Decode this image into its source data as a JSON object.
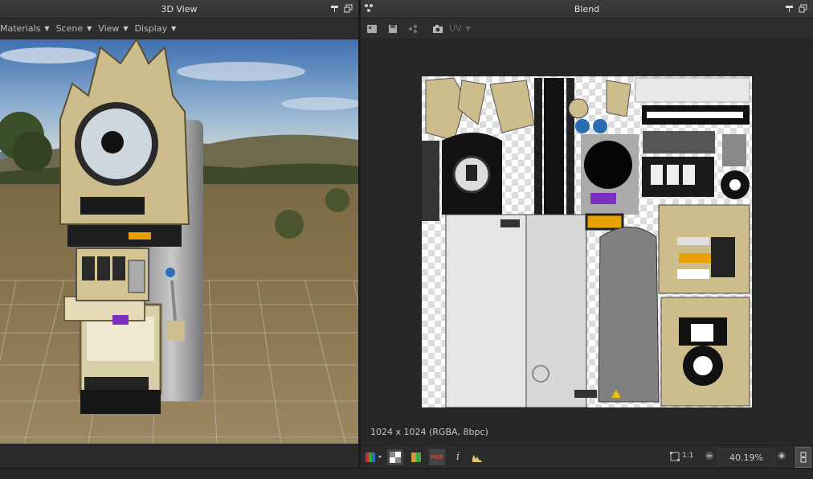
{
  "left_panel": {
    "title": "3D View",
    "menu": [
      {
        "label": "Materials"
      },
      {
        "label": "Scene"
      },
      {
        "label": "View"
      },
      {
        "label": "Display"
      }
    ]
  },
  "right_panel": {
    "title": "Blend",
    "toolbar": {
      "uv_label": "UV"
    },
    "image_info": "1024 x 1024 (RGBA, 8bpc)",
    "bottom_bar": {
      "one_to_one_label": "1:1",
      "zoom_value": "40.19%",
      "rgb_label": "RGB",
      "info_label": "i"
    }
  },
  "colors": {
    "accent": "#e0c27a",
    "panel_bg": "#303030",
    "titlebar_bg": "#3a3a3a"
  },
  "icons": [
    "pin-icon",
    "float-icon",
    "camera-icon",
    "grid-icon",
    "cursor-icon",
    "color-channel-icon",
    "checker-icon",
    "fit-icon",
    "zoom-out-icon",
    "zoom-in-icon",
    "histogram-icon"
  ]
}
